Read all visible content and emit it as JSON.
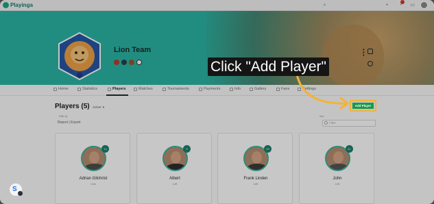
{
  "app": {
    "name": "Playinga"
  },
  "team": {
    "name": "Lion Team"
  },
  "callout": {
    "text": "Click \"Add Player\""
  },
  "nav": {
    "items": [
      {
        "label": "Home"
      },
      {
        "label": "Statistics"
      },
      {
        "label": "Players"
      },
      {
        "label": "Matches"
      },
      {
        "label": "Tournaments"
      },
      {
        "label": "Payments"
      },
      {
        "label": "Info"
      },
      {
        "label": "Gallery"
      },
      {
        "label": "Fans"
      },
      {
        "label": "Settings"
      }
    ],
    "active": "Players"
  },
  "players_section": {
    "title": "Players (5)",
    "active_label": "Active: 5",
    "filter_label": "Filter by",
    "report_export": "Report | Export",
    "sort_label": "Sort",
    "search_placeholder": "Filter",
    "add_button": "Add Player"
  },
  "players": [
    {
      "name": "Adrian Gilchrist",
      "role": "Link",
      "number": "14"
    },
    {
      "name": "Albert",
      "role": "Left",
      "number": "9"
    },
    {
      "name": "Frank Linden",
      "role": "Left",
      "number": "10"
    },
    {
      "name": "John",
      "role": "Left",
      "number": "41"
    }
  ],
  "colors": {
    "banner": "#2bb5a4",
    "add_button": "#1a9a49",
    "highlight": "#f3b336",
    "arrow": "#f3b336"
  }
}
